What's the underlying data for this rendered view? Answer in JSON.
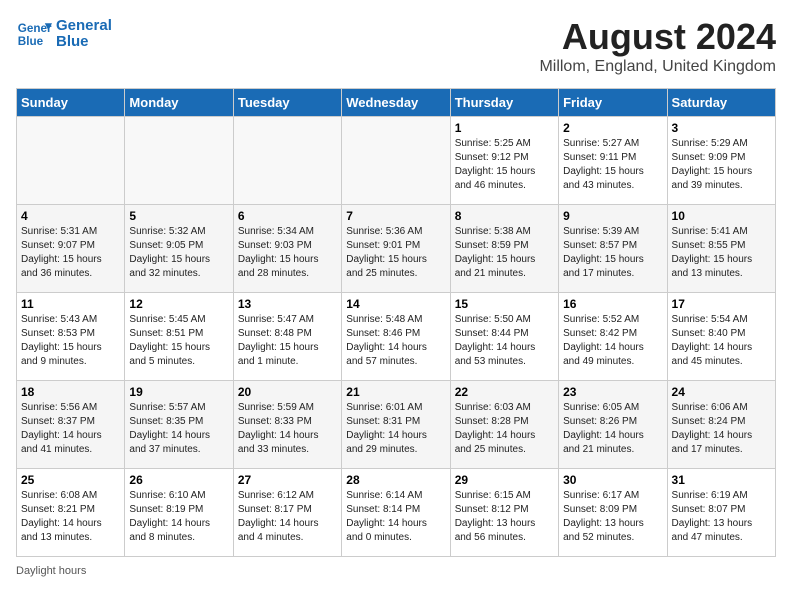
{
  "header": {
    "logo_line1": "General",
    "logo_line2": "Blue",
    "month_title": "August 2024",
    "location": "Millom, England, United Kingdom"
  },
  "days_of_week": [
    "Sunday",
    "Monday",
    "Tuesday",
    "Wednesday",
    "Thursday",
    "Friday",
    "Saturday"
  ],
  "footer_note": "Daylight hours",
  "weeks": [
    [
      {
        "day": "",
        "info": ""
      },
      {
        "day": "",
        "info": ""
      },
      {
        "day": "",
        "info": ""
      },
      {
        "day": "",
        "info": ""
      },
      {
        "day": "1",
        "info": "Sunrise: 5:25 AM\nSunset: 9:12 PM\nDaylight: 15 hours\nand 46 minutes."
      },
      {
        "day": "2",
        "info": "Sunrise: 5:27 AM\nSunset: 9:11 PM\nDaylight: 15 hours\nand 43 minutes."
      },
      {
        "day": "3",
        "info": "Sunrise: 5:29 AM\nSunset: 9:09 PM\nDaylight: 15 hours\nand 39 minutes."
      }
    ],
    [
      {
        "day": "4",
        "info": "Sunrise: 5:31 AM\nSunset: 9:07 PM\nDaylight: 15 hours\nand 36 minutes."
      },
      {
        "day": "5",
        "info": "Sunrise: 5:32 AM\nSunset: 9:05 PM\nDaylight: 15 hours\nand 32 minutes."
      },
      {
        "day": "6",
        "info": "Sunrise: 5:34 AM\nSunset: 9:03 PM\nDaylight: 15 hours\nand 28 minutes."
      },
      {
        "day": "7",
        "info": "Sunrise: 5:36 AM\nSunset: 9:01 PM\nDaylight: 15 hours\nand 25 minutes."
      },
      {
        "day": "8",
        "info": "Sunrise: 5:38 AM\nSunset: 8:59 PM\nDaylight: 15 hours\nand 21 minutes."
      },
      {
        "day": "9",
        "info": "Sunrise: 5:39 AM\nSunset: 8:57 PM\nDaylight: 15 hours\nand 17 minutes."
      },
      {
        "day": "10",
        "info": "Sunrise: 5:41 AM\nSunset: 8:55 PM\nDaylight: 15 hours\nand 13 minutes."
      }
    ],
    [
      {
        "day": "11",
        "info": "Sunrise: 5:43 AM\nSunset: 8:53 PM\nDaylight: 15 hours\nand 9 minutes."
      },
      {
        "day": "12",
        "info": "Sunrise: 5:45 AM\nSunset: 8:51 PM\nDaylight: 15 hours\nand 5 minutes."
      },
      {
        "day": "13",
        "info": "Sunrise: 5:47 AM\nSunset: 8:48 PM\nDaylight: 15 hours\nand 1 minute."
      },
      {
        "day": "14",
        "info": "Sunrise: 5:48 AM\nSunset: 8:46 PM\nDaylight: 14 hours\nand 57 minutes."
      },
      {
        "day": "15",
        "info": "Sunrise: 5:50 AM\nSunset: 8:44 PM\nDaylight: 14 hours\nand 53 minutes."
      },
      {
        "day": "16",
        "info": "Sunrise: 5:52 AM\nSunset: 8:42 PM\nDaylight: 14 hours\nand 49 minutes."
      },
      {
        "day": "17",
        "info": "Sunrise: 5:54 AM\nSunset: 8:40 PM\nDaylight: 14 hours\nand 45 minutes."
      }
    ],
    [
      {
        "day": "18",
        "info": "Sunrise: 5:56 AM\nSunset: 8:37 PM\nDaylight: 14 hours\nand 41 minutes."
      },
      {
        "day": "19",
        "info": "Sunrise: 5:57 AM\nSunset: 8:35 PM\nDaylight: 14 hours\nand 37 minutes."
      },
      {
        "day": "20",
        "info": "Sunrise: 5:59 AM\nSunset: 8:33 PM\nDaylight: 14 hours\nand 33 minutes."
      },
      {
        "day": "21",
        "info": "Sunrise: 6:01 AM\nSunset: 8:31 PM\nDaylight: 14 hours\nand 29 minutes."
      },
      {
        "day": "22",
        "info": "Sunrise: 6:03 AM\nSunset: 8:28 PM\nDaylight: 14 hours\nand 25 minutes."
      },
      {
        "day": "23",
        "info": "Sunrise: 6:05 AM\nSunset: 8:26 PM\nDaylight: 14 hours\nand 21 minutes."
      },
      {
        "day": "24",
        "info": "Sunrise: 6:06 AM\nSunset: 8:24 PM\nDaylight: 14 hours\nand 17 minutes."
      }
    ],
    [
      {
        "day": "25",
        "info": "Sunrise: 6:08 AM\nSunset: 8:21 PM\nDaylight: 14 hours\nand 13 minutes."
      },
      {
        "day": "26",
        "info": "Sunrise: 6:10 AM\nSunset: 8:19 PM\nDaylight: 14 hours\nand 8 minutes."
      },
      {
        "day": "27",
        "info": "Sunrise: 6:12 AM\nSunset: 8:17 PM\nDaylight: 14 hours\nand 4 minutes."
      },
      {
        "day": "28",
        "info": "Sunrise: 6:14 AM\nSunset: 8:14 PM\nDaylight: 14 hours\nand 0 minutes."
      },
      {
        "day": "29",
        "info": "Sunrise: 6:15 AM\nSunset: 8:12 PM\nDaylight: 13 hours\nand 56 minutes."
      },
      {
        "day": "30",
        "info": "Sunrise: 6:17 AM\nSunset: 8:09 PM\nDaylight: 13 hours\nand 52 minutes."
      },
      {
        "day": "31",
        "info": "Sunrise: 6:19 AM\nSunset: 8:07 PM\nDaylight: 13 hours\nand 47 minutes."
      }
    ]
  ]
}
